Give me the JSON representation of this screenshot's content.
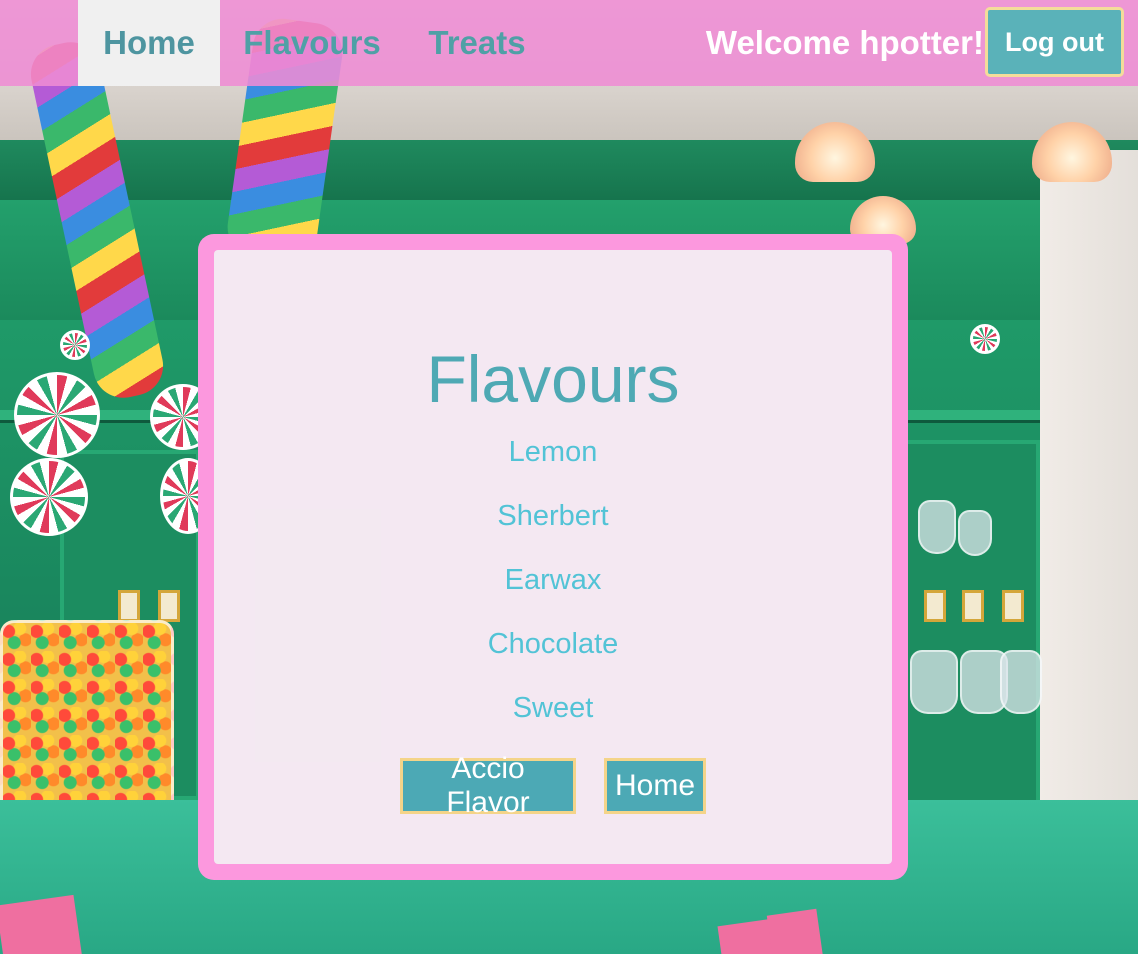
{
  "nav": {
    "links": [
      {
        "label": "Home",
        "active": true
      },
      {
        "label": "Flavours",
        "active": false
      },
      {
        "label": "Treats",
        "active": false
      }
    ],
    "welcome_text": "Welcome hpotter!",
    "logout_label": "Log out"
  },
  "card": {
    "title": "Flavours",
    "flavours": [
      "Lemon",
      "Sherbert",
      "Earwax",
      "Chocolate",
      "Sweet"
    ],
    "actions": {
      "accio_label": "Accio Flavor",
      "home_label": "Home"
    }
  },
  "colors": {
    "navbar_bg": "#ee8cd4",
    "nav_link_text": "#4fa0a6",
    "active_tab_bg": "#f0f0f0",
    "button_bg": "#5ab2b9",
    "button_border": "#f4dc9a",
    "card_frame": "#fc98de",
    "title_text": "#4ea9b4",
    "flavour_text": "#52c3d6"
  },
  "background": {
    "description_icon": "candy-shop-photo"
  }
}
